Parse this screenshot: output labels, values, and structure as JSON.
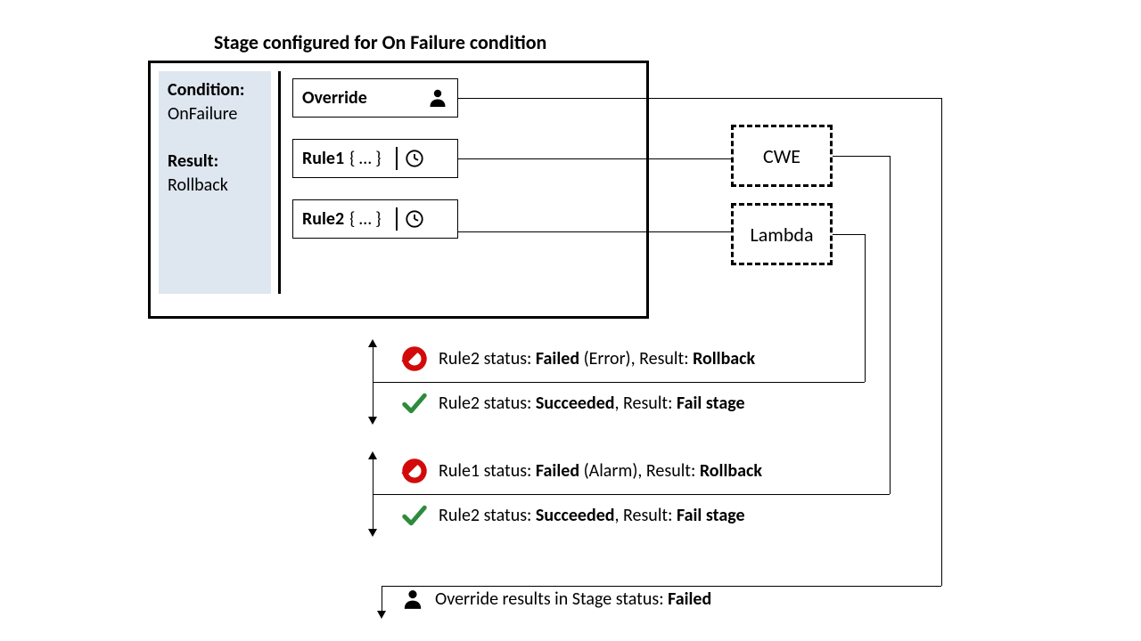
{
  "title": "Stage configured for On Failure condition",
  "sidebar": {
    "condition_label": "Condition:",
    "condition_value": "OnFailure",
    "result_label": "Result:",
    "result_value": "Rollback"
  },
  "rules": {
    "override": "Override",
    "rule1_name": "Rule1",
    "rule1_body": "{ … }",
    "rule2_name": "Rule2",
    "rule2_body": "{ … }"
  },
  "targets": {
    "cwe": "CWE",
    "lambda": "Lambda"
  },
  "statuses": {
    "r2_fail_pre": "Rule2 status: ",
    "r2_fail_status": "Failed",
    "r2_fail_mid": " (Error), Result: ",
    "r2_fail_result": "Rollback",
    "r2_succ_pre": "Rule2 status: ",
    "r2_succ_status": "Succeeded",
    "r2_succ_mid": ", Result: ",
    "r2_succ_result": "Fail stage",
    "r1_fail_pre": "Rule1 status: ",
    "r1_fail_status": "Failed",
    "r1_fail_mid": " (Alarm), Result: ",
    "r1_fail_result": "Rollback",
    "r1_succ_pre": "Rule2 status: ",
    "r1_succ_status": "Succeeded",
    "r1_succ_mid": ", Result: ",
    "r1_succ_result": "Fail stage",
    "override_pre": "Override results in Stage status: ",
    "override_status": "Failed"
  }
}
